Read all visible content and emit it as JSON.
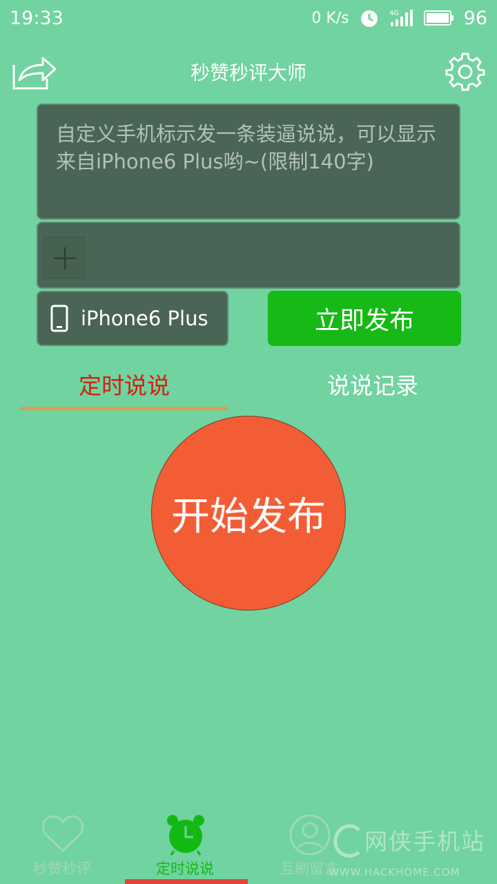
{
  "status_bar": {
    "time": "19:33",
    "net_speed": "0 K/s",
    "network": "4G",
    "battery": "96"
  },
  "header": {
    "title": "秒赞秒评大师"
  },
  "compose": {
    "placeholder": "自定义手机标示发一条装逼说说，可以显示来自iPhone6 Plus哟~(限制140字)",
    "device_label": "iPhone6 Plus",
    "publish_label": "立即发布"
  },
  "tabs": [
    {
      "label": "定时说说",
      "active": true
    },
    {
      "label": "说说记录",
      "active": false
    }
  ],
  "start_button": {
    "label": "开始发布"
  },
  "bottom_nav": [
    {
      "label": "秒赞秒评",
      "icon": "heart-icon",
      "active": false
    },
    {
      "label": "定时说说",
      "icon": "alarm-clock-icon",
      "active": true
    },
    {
      "label": "互刷留言",
      "icon": "user-icon",
      "active": false
    }
  ],
  "watermark": {
    "title": "网侠手机站",
    "url": "WWW.HACKHOME.COM"
  },
  "colors": {
    "background": "#70d3a0",
    "panel": "#4a6456",
    "publish_green": "#16b916",
    "start_orange": "#f35d36",
    "active_tab_red": "#d4200f",
    "tab_indicator": "#e09a4f"
  }
}
